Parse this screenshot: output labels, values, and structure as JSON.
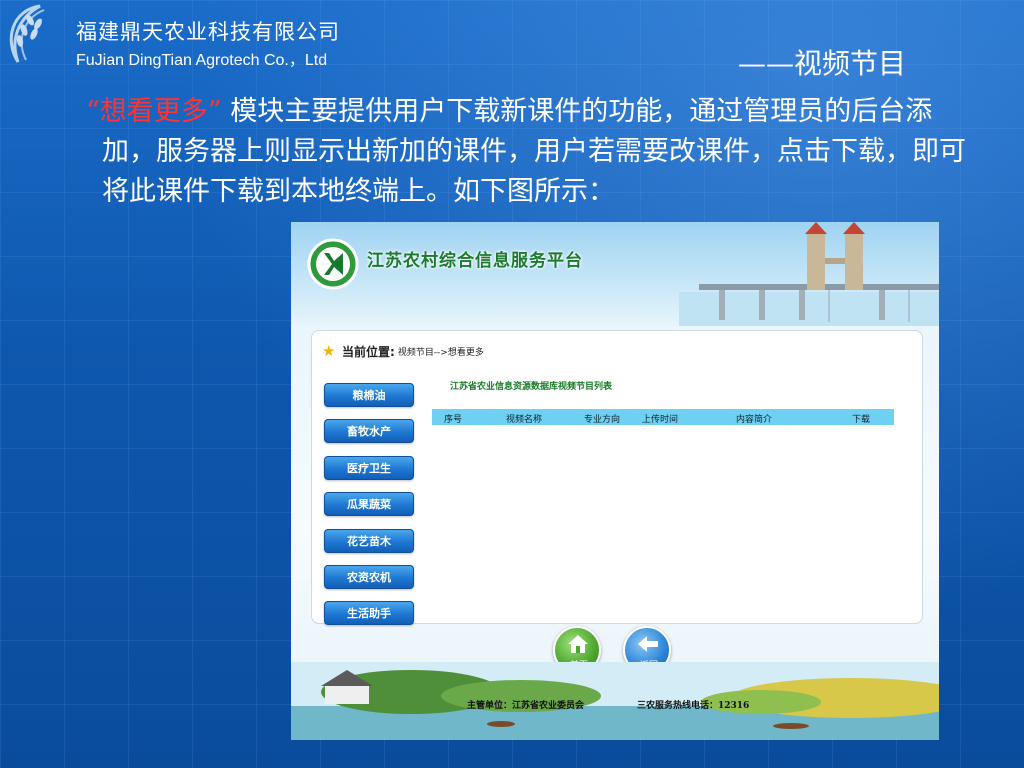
{
  "header": {
    "company_cn": "福建鼎天农业科技有限公司",
    "company_en": "FuJian DingTian Agrotech Co.，Ltd",
    "slide_title": "——视频节目"
  },
  "content": {
    "highlight": "“想看更多”",
    "text": "模块主要提供用户下载新课件的功能，通过管理员的后台添加，服务器上则显示出新加的课件，用户若需要改课件，点击下载，即可将此课件下载到本地终端上。如下图所示："
  },
  "screenshot": {
    "platform_title": "江苏农村综合信息服务平台",
    "breadcrumb": {
      "label": "当前位置:",
      "path": "视频节目-->想看更多"
    },
    "menu": [
      {
        "label": "粮棉油"
      },
      {
        "label": "畜牧水产"
      },
      {
        "label": "医疗卫生"
      },
      {
        "label": "瓜果蔬菜"
      },
      {
        "label": "花艺苗木"
      },
      {
        "label": "农资农机"
      },
      {
        "label": "生活助手"
      }
    ],
    "list_title": "江苏省农业信息资源数据库视频节目列表",
    "columns": [
      "序号",
      "视频名称",
      "专业方向",
      "上传时间",
      "内容简介",
      "下载"
    ],
    "buttons": {
      "home": "首页",
      "back": "返回"
    },
    "footer": {
      "sponsor": "主管单位：江苏省农业委员会",
      "hotline": "三农服务热线电话：12316"
    }
  },
  "colors": {
    "background": "#0d55a8",
    "highlight": "#ff3333",
    "menu_button": "#1e78d3",
    "table_header": "#6ed0f2",
    "platform_title": "#1b7a2f"
  },
  "icons": [
    "wheat-logo-icon",
    "kmark-logo-icon",
    "star-icon",
    "home-icon",
    "back-arrow-icon"
  ]
}
